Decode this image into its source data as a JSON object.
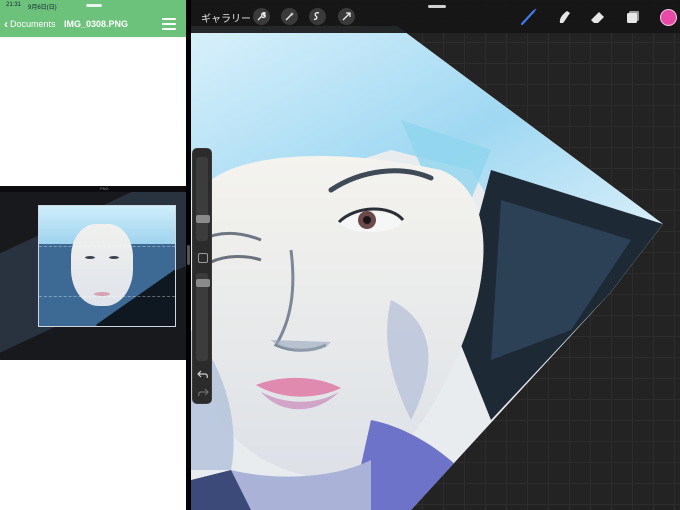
{
  "status_bar": {
    "time": "21:31",
    "date": "9月6日(日)"
  },
  "documents_app": {
    "back_label": "Documents",
    "file_name": "IMG_0308.PNG",
    "menu_icon": "hamburger-menu-icon",
    "back_icon": "chevron-left-icon"
  },
  "preview": {
    "title": "PNG"
  },
  "procreate": {
    "gallery_label": "ギャラリー",
    "actions": [
      "wrench-icon",
      "magic-wand-icon",
      "selection-icon",
      "transform-arrow-icon"
    ],
    "tools": [
      "brush-icon",
      "smudge-icon",
      "eraser-icon",
      "layers-icon"
    ],
    "current_color": "#e64aa6",
    "sidebar": {
      "undo_icon": "undo-arrow-icon",
      "redo_icon": "redo-arrow-icon"
    }
  },
  "colors": {
    "header_green": "#6cc27a",
    "brush_active": "#3d7cf0"
  }
}
